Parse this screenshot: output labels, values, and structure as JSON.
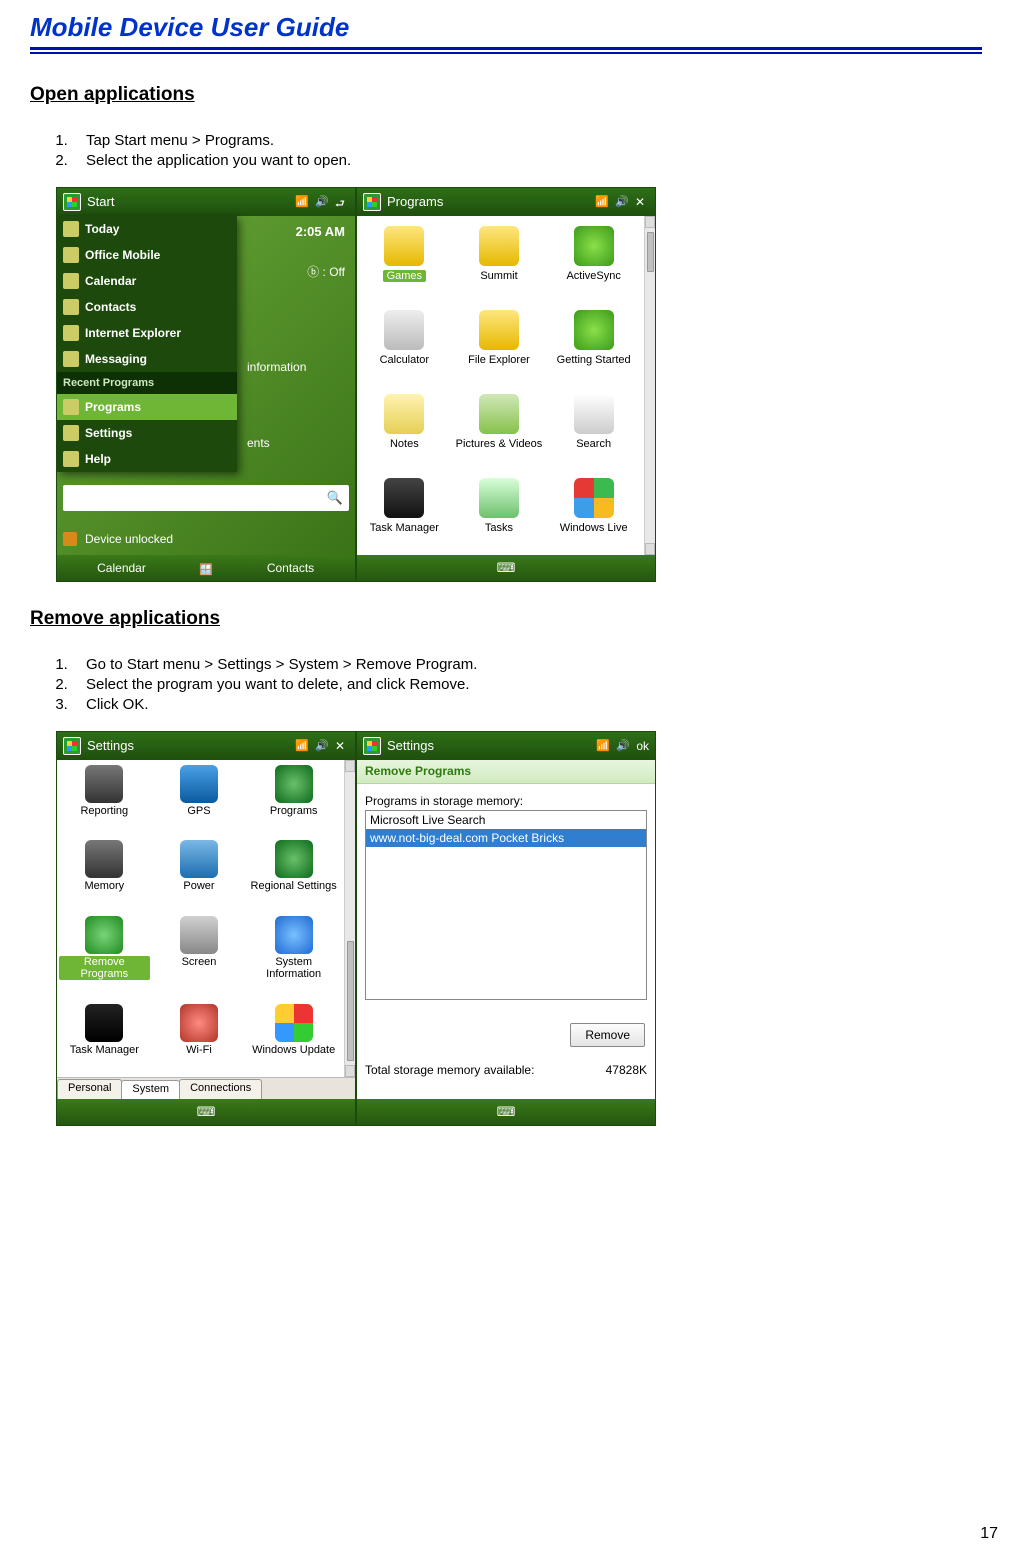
{
  "doc_title": "Mobile Device User Guide",
  "page_number": "17",
  "sections": {
    "open_apps": {
      "heading": "Open applications",
      "steps": [
        "Tap Start menu > Programs.",
        "Select the application you want to open."
      ]
    },
    "remove_apps": {
      "heading": "Remove applications",
      "steps": [
        "Go to Start menu > Settings > System > Remove Program.",
        "Select the program you want to delete, and click Remove.",
        "Click OK."
      ]
    }
  },
  "fig1": {
    "start_pane": {
      "title": "Start",
      "time": "2:05 AM",
      "bluetooth": "ⓑ : Off",
      "info_hint": "information",
      "ents_hint": "ents",
      "menu": {
        "items_top": [
          "Today",
          "Office Mobile",
          "Calendar",
          "Contacts",
          "Internet Explorer",
          "Messaging"
        ],
        "section_label": "Recent Programs",
        "items_bottom": [
          "Programs",
          "Settings",
          "Help"
        ],
        "selected": "Programs"
      },
      "unlock_text": "Device unlocked",
      "bottom": {
        "left": "Calendar",
        "right": "Contacts"
      }
    },
    "programs_pane": {
      "title": "Programs",
      "items": [
        {
          "label": "Games",
          "cls": "c-folder",
          "sel": true
        },
        {
          "label": "Summit",
          "cls": "c-yellowfold"
        },
        {
          "label": "ActiveSync",
          "cls": "c-green"
        },
        {
          "label": "Calculator",
          "cls": "c-calc"
        },
        {
          "label": "File Explorer",
          "cls": "c-yellowfold"
        },
        {
          "label": "Getting Started",
          "cls": "c-green"
        },
        {
          "label": "Notes",
          "cls": "c-note"
        },
        {
          "label": "Pictures & Videos",
          "cls": "c-pic"
        },
        {
          "label": "Search",
          "cls": "c-search"
        },
        {
          "label": "Task Manager",
          "cls": "c-task"
        },
        {
          "label": "Tasks",
          "cls": "c-tasks"
        },
        {
          "label": "Windows Live",
          "cls": "c-wlive"
        }
      ]
    }
  },
  "fig2": {
    "settings_pane": {
      "title": "Settings",
      "tabs": [
        "Personal",
        "System",
        "Connections"
      ],
      "active_tab": "System",
      "items": [
        {
          "label": "Reporting",
          "cls": "c-chip"
        },
        {
          "label": "GPS",
          "cls": "c-gps"
        },
        {
          "label": "Programs",
          "cls": "c-globe"
        },
        {
          "label": "Memory",
          "cls": "c-chip"
        },
        {
          "label": "Power",
          "cls": "c-batt"
        },
        {
          "label": "Regional Settings",
          "cls": "c-region"
        },
        {
          "label": "Remove Programs",
          "cls": "c-recycle",
          "sel": true
        },
        {
          "label": "Screen",
          "cls": "c-screen"
        },
        {
          "label": "System Information",
          "cls": "c-info"
        },
        {
          "label": "Task Manager",
          "cls": "c-taskmgr"
        },
        {
          "label": "Wi-Fi",
          "cls": "c-wifi"
        },
        {
          "label": "Windows Update",
          "cls": "c-winupd"
        }
      ]
    },
    "remove_pane": {
      "title": "Settings",
      "ok_label": "ok",
      "breadcrumb": "Remove Programs",
      "list_label": "Programs in storage memory:",
      "list_items": [
        {
          "text": "Microsoft Live Search"
        },
        {
          "text": "www.not-big-deal.com Pocket Bricks",
          "sel": true
        }
      ],
      "remove_btn": "Remove",
      "storage_label": "Total storage memory available:",
      "storage_value": "47828K"
    }
  }
}
